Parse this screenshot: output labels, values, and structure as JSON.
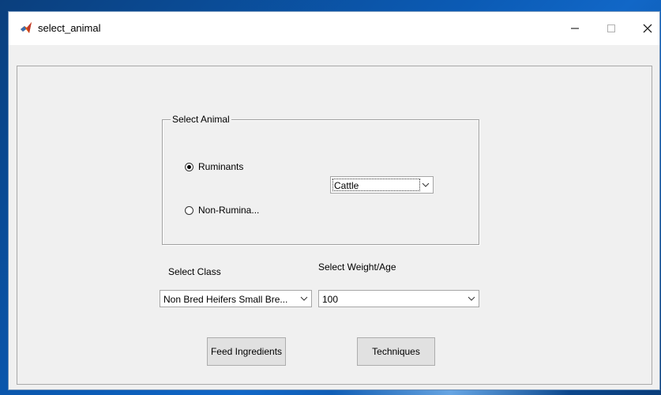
{
  "window": {
    "title": "select_animal"
  },
  "animal_group": {
    "title": "Select Animal",
    "radio_ruminants": {
      "label": "Ruminants",
      "selected": true
    },
    "radio_non_ruminants": {
      "label": "Non-Rumina...",
      "selected": false
    },
    "animal_select": {
      "value": "Cattle"
    }
  },
  "class_section": {
    "label": "Select Class",
    "select_value": "Non Bred Heifers Small Bre..."
  },
  "weight_section": {
    "label": "Select Weight/Age",
    "select_value": "100"
  },
  "buttons": {
    "feed_ingredients": "Feed Ingredients",
    "techniques": "Techniques"
  },
  "colors": {
    "window_bg": "#f0f0f0",
    "titlebar_bg": "#ffffff",
    "desktop_blue": "#0b5bb5",
    "button_bg": "#e1e1e1"
  },
  "icons": {
    "app": "matlab-icon",
    "minimize": "minimize-icon",
    "maximize": "maximize-icon",
    "close": "close-icon",
    "dropdown": "chevron-down-icon"
  }
}
